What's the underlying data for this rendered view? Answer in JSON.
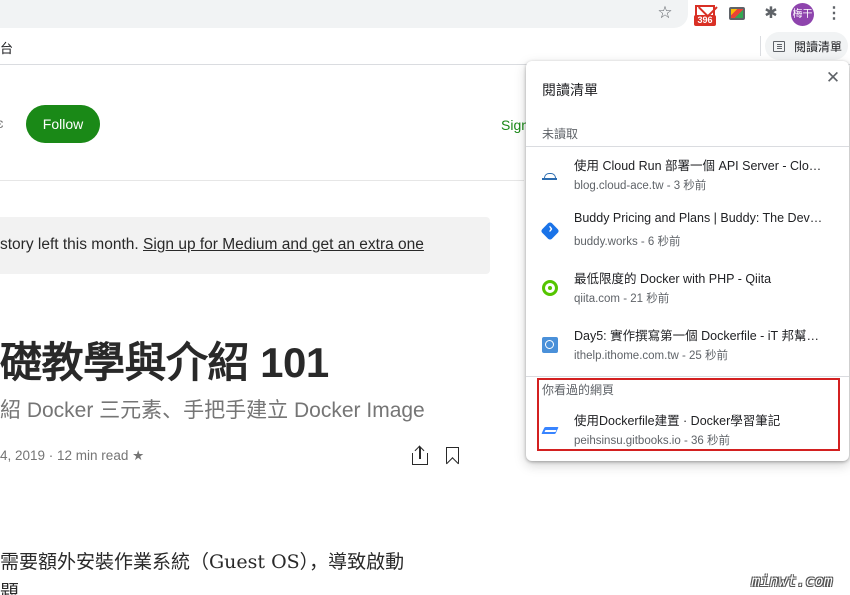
{
  "chrome": {
    "gmail_count": "396",
    "avatar_text": "梅干",
    "bookmark_left_fragment": "台"
  },
  "reading_list_button": {
    "label": "閱讀清單"
  },
  "page": {
    "crop_left_mark": "ɛ",
    "follow_label": "Follow",
    "signin_fragment": "Sign",
    "banner_prefix": "story left this month. ",
    "banner_link": "Sign up for Medium and get an extra one",
    "title": "礎教學與介紹 101",
    "subtitle": "紹 Docker 三元素、手把手建立 Docker Image",
    "meta": "4, 2019  ·  12 min read ★",
    "body_line1": "需要額外安裝作業系統（Guest OS），導致啟動",
    "body_line2": "題"
  },
  "reading_list": {
    "title": "閱讀清單",
    "unread_header": "未讀取",
    "read_header": "你看過的網頁",
    "unread_items": [
      {
        "title": "使用 Cloud Run 部署一個 API Server - Clo…",
        "subtitle": "blog.cloud-ace.tw - 3 秒前",
        "icon": "cloud-ace-icon"
      },
      {
        "title": "Buddy Pricing and Plans | Buddy: The Dev…",
        "subtitle": "buddy.works - 6 秒前",
        "icon": "buddy-icon"
      },
      {
        "title": "最低限度的 Docker with PHP - Qiita",
        "subtitle": "qiita.com - 21 秒前",
        "icon": "qiita-icon"
      },
      {
        "title": "Day5: 實作撰寫第一個 Dockerfile - iT 邦幫…",
        "subtitle": "ithelp.ithome.com.tw - 25 秒前",
        "icon": "ithome-icon"
      }
    ],
    "read_items": [
      {
        "title": "使用Dockerfile建置 · Docker學習筆記",
        "subtitle": "peihsinsu.gitbooks.io - 36 秒前",
        "icon": "gitbook-icon"
      }
    ]
  },
  "watermark": "minwt.com",
  "colors": {
    "follow_green": "#1a8917",
    "highlight_red": "#d32020",
    "avatar_purple": "#8e44ad"
  }
}
